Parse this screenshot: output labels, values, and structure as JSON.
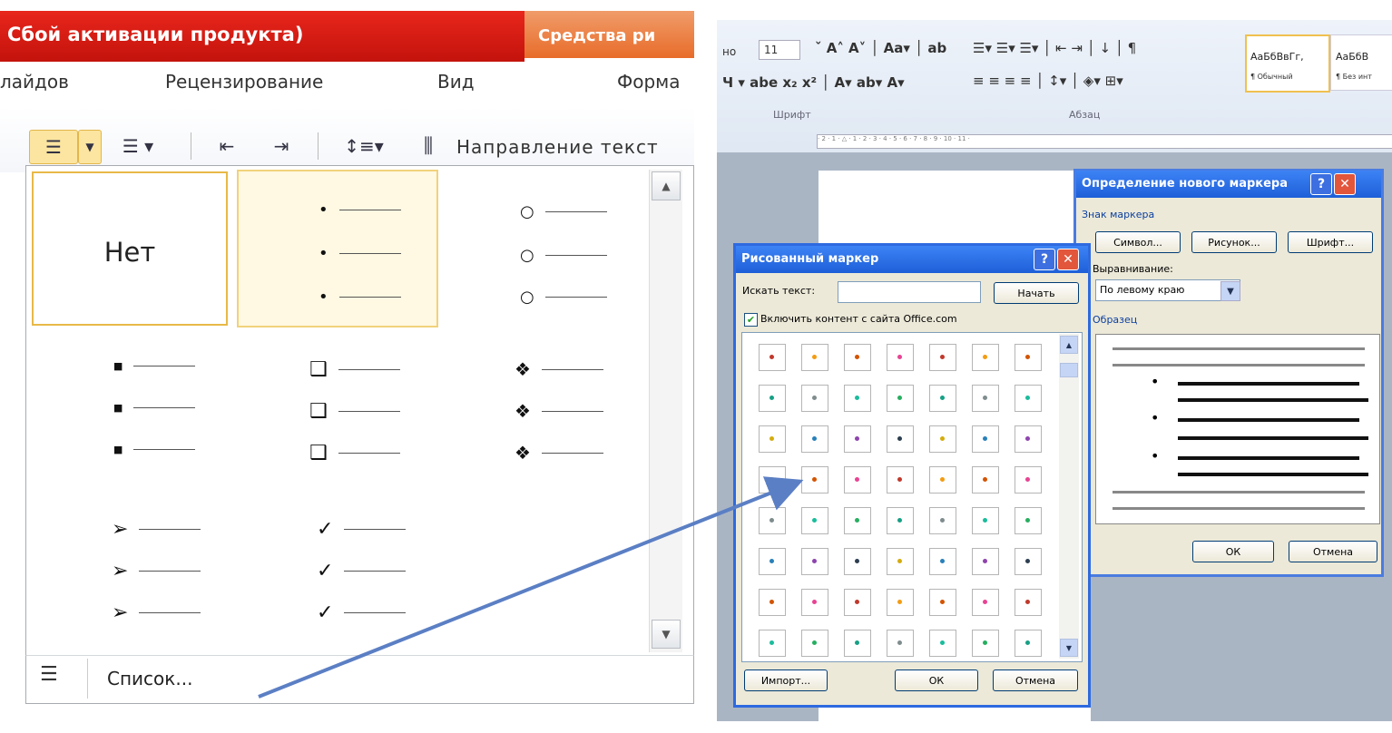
{
  "left": {
    "title": "Сбой активации продукта)",
    "context_tab": "Средства ри",
    "tabs": [
      "лайдов",
      "Рецензирование",
      "Вид",
      "Форма"
    ],
    "text_direction_label": "Направление текст",
    "gallery": {
      "none_label": "Нет"
    },
    "list_label": "Список..."
  },
  "right": {
    "ribbon": {
      "font_size": "11",
      "font_name": "но",
      "group_font": "Шрифт",
      "group_paragraph": "Абзац",
      "style1_sample": "АаБбВвГг,",
      "style1_name": "¶ Обычный",
      "style2_sample": "АаБбВ",
      "style2_name": "¶ Без инт"
    },
    "define_bullet_dialog": {
      "title": "Определение нового маркера",
      "section_marker": "Знак маркера",
      "btn_symbol": "Символ...",
      "btn_picture": "Рисунок...",
      "btn_font": "Шрифт...",
      "alignment_label": "Выравнивание:",
      "alignment_value": "По левому краю",
      "sample_label": "Образец",
      "ok": "ОК",
      "cancel": "Отмена"
    },
    "picture_bullet_dialog": {
      "title": "Рисованный маркер",
      "search_label": "Искать текст:",
      "start_button": "Начать",
      "include_office_label": "Включить контент с сайта Office.com",
      "import_button": "Импорт...",
      "ok": "ОК",
      "cancel": "Отмена"
    }
  },
  "colors": {
    "title_red": "#d51c12",
    "context_orange": "#e86c2a",
    "xp_blue": "#1e5fd8",
    "arrow": "#5b7fc4"
  }
}
